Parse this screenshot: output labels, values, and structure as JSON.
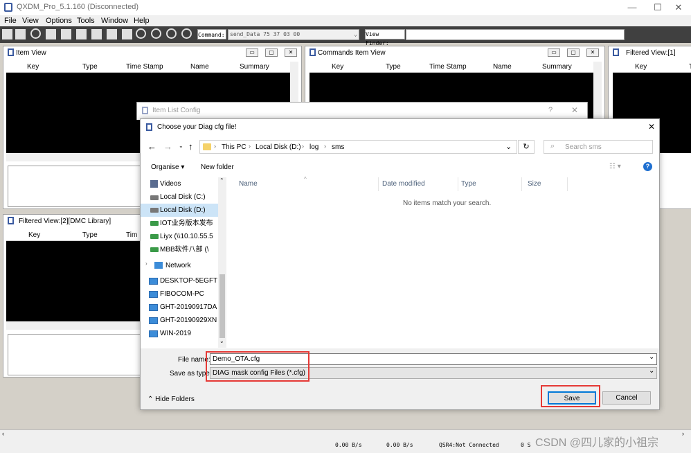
{
  "app": {
    "title": "QXDM_Pro_5.1.160 (Disconnected)",
    "menu": [
      "File",
      "View",
      "Options",
      "Tools",
      "Window",
      "Help"
    ],
    "command_label": "Command:",
    "command_value": "send_Data 75 37 03 00",
    "view_finder_label": "View Finder:"
  },
  "panels": {
    "item_view": {
      "title": "Item View",
      "columns": [
        "Key",
        "Type",
        "Time Stamp",
        "Name",
        "Summary"
      ]
    },
    "commands_item_view": {
      "title": "Commands Item View",
      "columns": [
        "Key",
        "Type",
        "Time Stamp",
        "Name",
        "Summary"
      ]
    },
    "filtered_view_1": {
      "title": "Filtered View:[1]",
      "columns": [
        "Key",
        "T"
      ]
    },
    "filtered_view_2": {
      "title": "Filtered View:[2][DMC Library]",
      "columns": [
        "Key",
        "Type",
        "Tim"
      ]
    }
  },
  "item_list_config": {
    "title": "Item List Config",
    "help": "?",
    "close": "✕"
  },
  "file_dialog": {
    "title": "Choose your Diag cfg file!",
    "close": "✕",
    "breadcrumb": [
      "This PC",
      "Local Disk (D:)",
      "log",
      "sms"
    ],
    "search_placeholder": "Search sms",
    "organise": "Organise",
    "new_folder": "New folder",
    "help_symbol": "?",
    "columns": [
      "Name",
      "Date modified",
      "Type",
      "Size"
    ],
    "empty_message": "No items match your search.",
    "nav_items": [
      {
        "label": "Videos",
        "icon": "video-folder-icon"
      },
      {
        "label": "Local Disk (C:)",
        "icon": "drive-icon"
      },
      {
        "label": "Local Disk (D:)",
        "icon": "drive-icon",
        "selected": true
      },
      {
        "label": "IOT业务版本发布",
        "icon": "network-drive-icon"
      },
      {
        "label": "Liyx (\\\\10.10.55.5",
        "icon": "network-drive-icon"
      },
      {
        "label": "MBB软件八部 (\\",
        "icon": "network-drive-icon"
      }
    ],
    "network_label": "Network",
    "network_items": [
      "DESKTOP-5EGFT",
      "FIBOCOM-PC",
      "GHT-20190917DA",
      "GHT-20190929XN",
      "WIN-2019"
    ],
    "file_name_label": "File name:",
    "file_name_value": "Demo_OTA.cfg",
    "save_as_type_label": "Save as type:",
    "save_as_type_value": "DIAG mask config Files (*.cfg)",
    "hide_folders": "Hide Folders",
    "save": "Save",
    "cancel": "Cancel"
  },
  "status": {
    "rate1": "0.00 B/s",
    "rate2": "0.00 B/s",
    "qsr": "QSR4:Not Connected",
    "s": "0 S",
    "watermark": "CSDN @四儿家的小祖宗"
  }
}
